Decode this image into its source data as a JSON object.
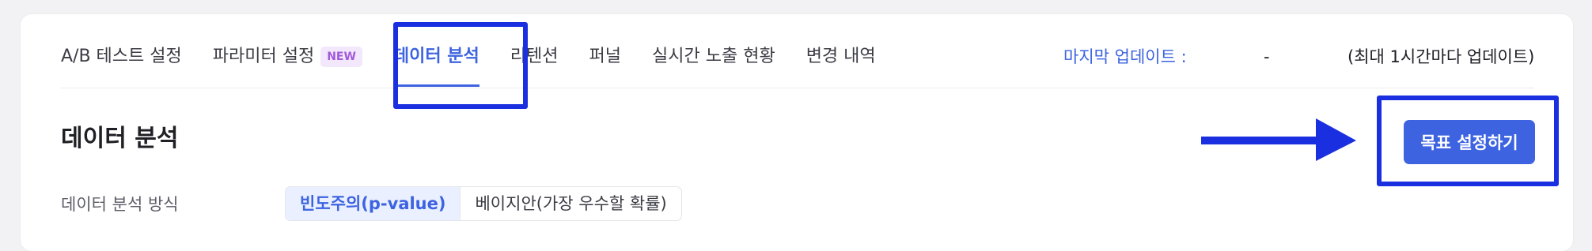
{
  "tabs": [
    {
      "label": "A/B 테스트 설정"
    },
    {
      "label": "파라미터 설정",
      "badge": "NEW"
    },
    {
      "label": "데이터 분석"
    },
    {
      "label": "리텐션"
    },
    {
      "label": "퍼널"
    },
    {
      "label": "실시간 노출 현황"
    },
    {
      "label": "변경 내역"
    }
  ],
  "active_tab": "데이터 분석",
  "update": {
    "label": "마지막 업데이트 :",
    "value": "-",
    "note": "(최대 1시간마다 업데이트)"
  },
  "page": {
    "title": "데이터 분석",
    "goal_button": "목표 설정하기"
  },
  "analysis": {
    "label": "데이터 분석 방식",
    "options": [
      "빈도주의(p-value)",
      "베이지안(가장 우수할 확률)"
    ],
    "selected": "빈도주의(p-value)"
  },
  "colors": {
    "accent": "#3d63e0",
    "badge_text": "#a25ad9",
    "annotation": "#1a2fe0"
  }
}
